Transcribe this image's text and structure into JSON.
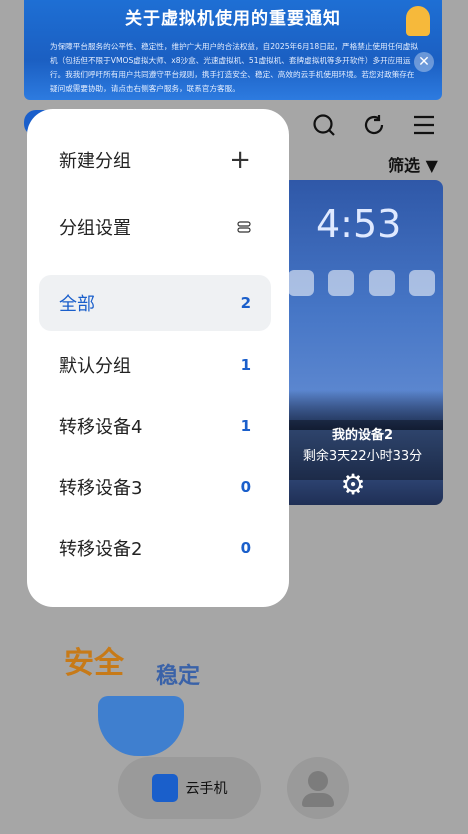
{
  "banner": {
    "title": "关于虚拟机使用的重要通知",
    "body": "为保障平台服务的公平性、稳定性，维护广大用户的合法权益，自2025年6月18日起，严格禁止使用任何虚拟机（包括但不限于VMOS虚拟大师、x8沙盒、光速虚拟机、51虚拟机、套牌虚拟机等多开软件）多开应用运行。我我们呼吁所有用户共同遵守平台规则，携手打造安全、稳定、高效的云手机使用环境。若您对政策存在疑问或需要协助，请点击右侧客户服务，联系官方客服。"
  },
  "toolbar": {
    "filter_label": "筛选 ▼"
  },
  "device_card": {
    "time": "4:53",
    "name": "我的设备2",
    "remaining": "剩余3天22小时33分"
  },
  "promo": {
    "text_a": "安全",
    "text_b": "稳定"
  },
  "bottom_nav": {
    "phone_label": "云手机"
  },
  "menu": {
    "new_group": "新建分组",
    "group_settings": "分组设置",
    "groups": [
      {
        "label": "全部",
        "count": "2"
      },
      {
        "label": "默认分组",
        "count": "1"
      },
      {
        "label": "转移设备4",
        "count": "1"
      },
      {
        "label": "转移设备3",
        "count": "0"
      },
      {
        "label": "转移设备2",
        "count": "0"
      }
    ]
  },
  "colors": {
    "accent": "#1a5fcb",
    "overlay": "#a6a6a6"
  }
}
